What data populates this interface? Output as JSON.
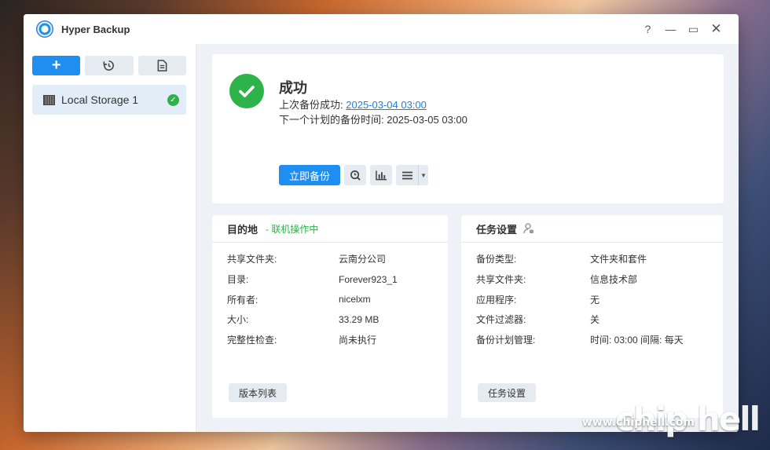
{
  "window": {
    "title": "Hyper Backup",
    "controls": [
      "?",
      "—",
      "▭",
      "✕"
    ]
  },
  "sidebar": {
    "toolbar": {
      "add_label": "+",
      "restore_icon": "history-icon",
      "log_icon": "document-icon"
    },
    "tasks": [
      {
        "label": "Local Storage 1",
        "status_icon": "check-circle-icon"
      }
    ]
  },
  "status": {
    "title": "成功",
    "last_backup_label": "上次备份成功:",
    "last_backup_time": "2025-03-04 03:00",
    "next_backup_label": "下一个计划的备份时间:",
    "next_backup_time": "2025-03-05 03:00",
    "backup_now_label": "立即备份"
  },
  "destination": {
    "title": "目的地",
    "status": "- 联机操作中",
    "rows": [
      {
        "k": "共享文件夹:",
        "v": "云南分公司"
      },
      {
        "k": "目录:",
        "v": "Forever923_1"
      },
      {
        "k": "所有者:",
        "v": "nicelxm"
      },
      {
        "k": "大小:",
        "v": "33.29 MB"
      },
      {
        "k": "完整性检查:",
        "v": "尚未执行"
      }
    ],
    "button_label": "版本列表"
  },
  "task_settings": {
    "title": "任务设置",
    "rows": [
      {
        "k": "备份类型:",
        "v": "文件夹和套件"
      },
      {
        "k": "共享文件夹:",
        "v": "信息技术部"
      },
      {
        "k": "应用程序:",
        "v": "无"
      },
      {
        "k": "文件过滤器:",
        "v": "关"
      },
      {
        "k": "备份计划管理:",
        "v": "时间: 03:00 间隔: 每天"
      }
    ],
    "button_label": "任务设置"
  },
  "watermark": {
    "url": "www.chiphell.com",
    "logo": "chip hell"
  }
}
